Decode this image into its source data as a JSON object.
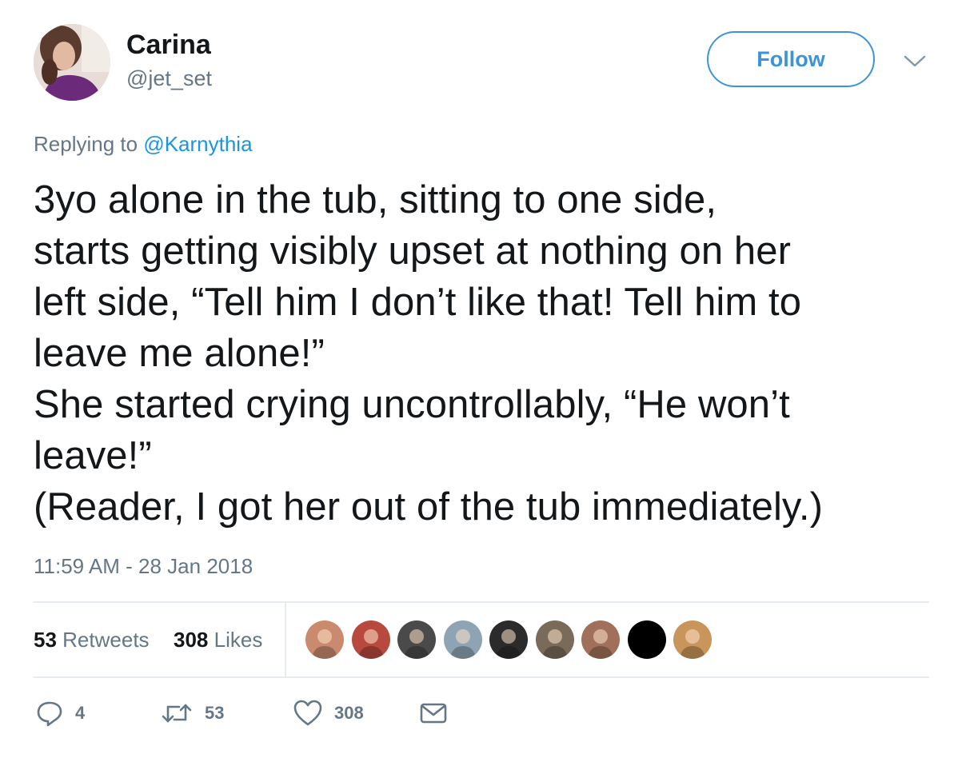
{
  "author": {
    "display_name": "Carina",
    "handle": "@jet_set",
    "avatar_icon": "user-avatar-photo"
  },
  "header": {
    "follow_label": "Follow",
    "caret_icon": "chevron-down-icon"
  },
  "reply": {
    "prefix": "Replying to",
    "mention": "@Karnythia"
  },
  "tweet": {
    "lines": [
      "3yo alone in the tub, sitting to one side,",
      "starts getting visibly upset at nothing on her",
      "left side, “Tell him I don’t like that! Tell him to",
      "leave me alone!”",
      "She started crying uncontrollably, “He won’t",
      "leave!”",
      "(Reader, I got her out of the tub immediately.)"
    ],
    "timestamp": "11:59 AM - 28 Jan 2018"
  },
  "stats": {
    "retweets_count": "53",
    "retweets_label": "Retweets",
    "likes_count": "308",
    "likes_label": "Likes",
    "likers": [
      {
        "icon": "liker-avatar-1",
        "color": "#c98a6e"
      },
      {
        "icon": "liker-avatar-2",
        "color": "#b8493f"
      },
      {
        "icon": "liker-avatar-3",
        "color": "#4a4a4a"
      },
      {
        "icon": "liker-avatar-4",
        "color": "#8ea4b5"
      },
      {
        "icon": "liker-avatar-5",
        "color": "#2b2b2b"
      },
      {
        "icon": "liker-avatar-6",
        "color": "#7a6a5a"
      },
      {
        "icon": "liker-avatar-7",
        "color": "#a0705a"
      },
      {
        "icon": "liker-avatar-8",
        "color": "#000000"
      },
      {
        "icon": "liker-avatar-9",
        "color": "#c9955a"
      }
    ]
  },
  "actions": {
    "reply_icon": "reply-icon",
    "reply_count": "4",
    "retweet_icon": "retweet-icon",
    "retweet_count": "53",
    "like_icon": "heart-icon",
    "like_count": "308",
    "dm_icon": "envelope-icon"
  },
  "colors": {
    "accent": "#1b95e0",
    "follow_blue": "#3b94d9",
    "muted": "#657786",
    "text": "#14171a",
    "border": "#e6ecf0"
  }
}
